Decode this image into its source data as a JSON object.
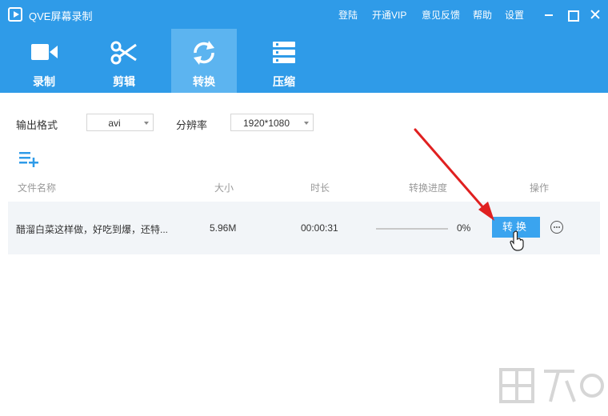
{
  "app": {
    "title": "QVE屏幕录制"
  },
  "top_links": [
    "登陆",
    "开通VIP",
    "意见反馈",
    "帮助",
    "设置"
  ],
  "tabs": [
    {
      "label": "录制",
      "icon": "video-camera-icon"
    },
    {
      "label": "剪辑",
      "icon": "scissors-icon"
    },
    {
      "label": "转换",
      "icon": "refresh-icon",
      "active": true
    },
    {
      "label": "压缩",
      "icon": "compress-icon"
    }
  ],
  "toolbar": {
    "format_label": "输出格式",
    "format_value": "avi",
    "resolution_label": "分辨率",
    "resolution_value": "1920*1080"
  },
  "columns": [
    "文件名称",
    "大小",
    "时长",
    "转换进度",
    "操作"
  ],
  "file": {
    "name": "醋溜白菜这样做，好吃到爆，还特...",
    "size": "5.96M",
    "duration": "00:00:31",
    "progress_text": "0%",
    "progress": 0,
    "convert_label": "转换"
  },
  "colors": {
    "accent": "#2f9be8",
    "active_tab": "#5cb4f0",
    "button": "#3aa4ef",
    "annotation": "#e02020"
  }
}
